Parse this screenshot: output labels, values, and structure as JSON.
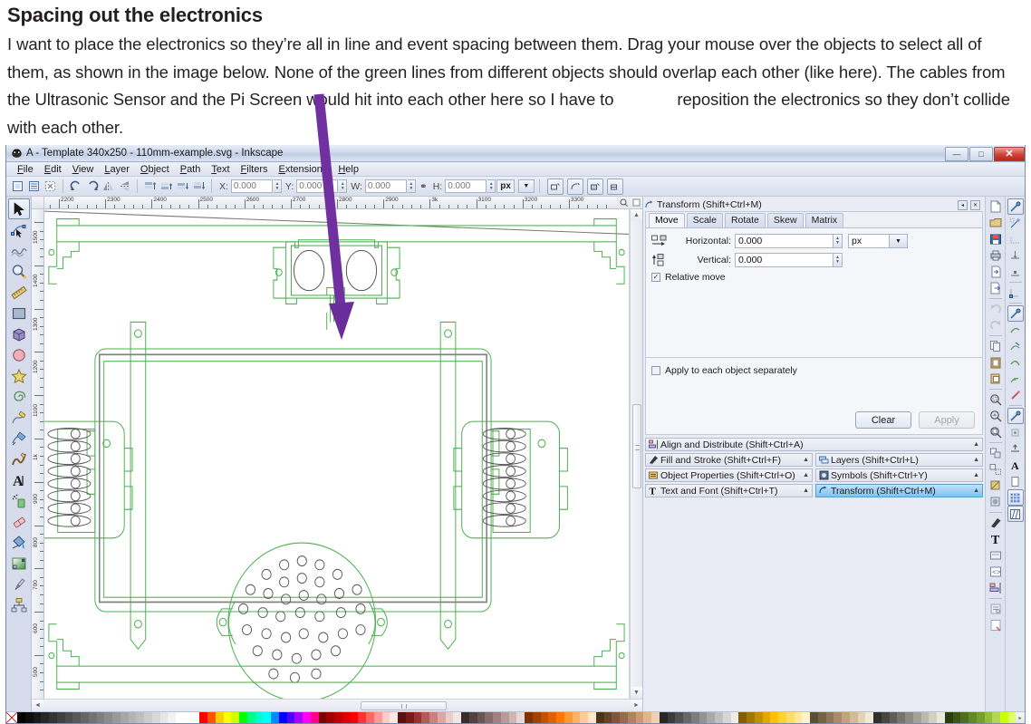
{
  "article": {
    "heading": "Spacing out the electronics",
    "body_part1": "I want to place the electronics so they’re all in line and event spacing between them. Drag your mouse over the objects to select all of them, as shown in the image below. None of the green lines from different objects should overlap each other (like here). The cables from the Ultrasonic Sensor and the Pi Screen would hit into each other here so I have to",
    "body_part2": "reposition the electronics so they don’t collide with each other."
  },
  "window": {
    "title": "A - Template 340x250 - 110mm-example.svg - Inkscape",
    "minimize_label": "—",
    "maximize_label": "□",
    "close_label": "✕"
  },
  "menubar": {
    "items": [
      "File",
      "Edit",
      "View",
      "Layer",
      "Object",
      "Path",
      "Text",
      "Filters",
      "Extensions",
      "Help"
    ]
  },
  "toolctl": {
    "x_label": "X:",
    "x_value": "0.000",
    "y_label": "Y:",
    "y_value": "0.000",
    "w_label": "W:",
    "w_value": "0.000",
    "lock_label": "⚭",
    "h_label": "H:",
    "h_value": "0.000",
    "unit": "px",
    "unit_arrow": "▼"
  },
  "toolbox": {
    "items": [
      {
        "name": "selector-tool",
        "selected": true
      },
      {
        "name": "node-editor-tool",
        "selected": false
      },
      {
        "name": "tweak-tool",
        "selected": false
      },
      {
        "name": "zoom-tool",
        "selected": false
      },
      {
        "name": "measure-tool",
        "selected": false
      },
      {
        "name": "rectangle-tool",
        "selected": false
      },
      {
        "name": "3d-box-tool",
        "selected": false
      },
      {
        "name": "ellipse-tool",
        "selected": false
      },
      {
        "name": "star-tool",
        "selected": false
      },
      {
        "name": "spiral-tool",
        "selected": false
      },
      {
        "name": "pencil-tool",
        "selected": false
      },
      {
        "name": "bezier-pen-tool",
        "selected": false
      },
      {
        "name": "calligraphy-tool",
        "selected": false
      },
      {
        "name": "text-tool",
        "selected": false
      },
      {
        "name": "spray-tool",
        "selected": false
      },
      {
        "name": "eraser-tool",
        "selected": false
      },
      {
        "name": "paint-bucket-tool",
        "selected": false
      },
      {
        "name": "gradient-tool",
        "selected": false
      },
      {
        "name": "dropper-tool",
        "selected": false
      },
      {
        "name": "connector-tool",
        "selected": false
      }
    ]
  },
  "rulers": {
    "horizontal_unit": "px",
    "horizontal_labels": [
      "2200",
      "2300",
      "2400",
      "2500",
      "2600",
      "2700",
      "2800",
      "2900",
      "3k",
      "3100",
      "3200",
      "3300"
    ],
    "vertical_labels": [
      "1500",
      "1400",
      "1300",
      "1200",
      "1100",
      "1k",
      "900",
      "800",
      "700",
      "600",
      "500"
    ]
  },
  "transform_panel": {
    "title": "Transform (Shift+Ctrl+M)",
    "collapse_label": "◂",
    "close_label": "✕",
    "tabs": [
      {
        "label": "Move",
        "active": true
      },
      {
        "label": "Scale",
        "active": false
      },
      {
        "label": "Rotate",
        "active": false
      },
      {
        "label": "Skew",
        "active": false
      },
      {
        "label": "Matrix",
        "active": false
      }
    ],
    "horizontal_label": "Horizontal:",
    "horizontal_value": "0.000",
    "vertical_label": "Vertical:",
    "vertical_value": "0.000",
    "unit": "px",
    "unit_arrow": "▼",
    "relative_move_label": "Relative move",
    "relative_move_checked": true,
    "apply_each_label": "Apply to each object separately",
    "apply_each_checked": false,
    "clear_button": "Clear",
    "apply_button": "Apply"
  },
  "dock_dialogs": [
    {
      "label": "Align and Distribute (Shift+Ctrl+A)",
      "icon": "align-icon",
      "active": false,
      "full_width": true
    },
    {
      "label": "Fill and Stroke (Shift+Ctrl+F)",
      "icon": "fill-stroke-icon",
      "active": false
    },
    {
      "label": "Layers (Shift+Ctrl+L)",
      "icon": "layers-icon",
      "active": false
    },
    {
      "label": "Object Properties (Shift+Ctrl+O)",
      "icon": "object-properties-icon",
      "active": false
    },
    {
      "label": "Symbols (Shift+Ctrl+Y)",
      "icon": "symbols-icon",
      "active": false
    },
    {
      "label": "Text and Font (Shift+Ctrl+T)",
      "icon": "text-font-icon",
      "active": false
    },
    {
      "label": "Transform (Shift+Ctrl+M)",
      "icon": "transform-icon",
      "active": true
    }
  ],
  "command_bar": {
    "items": [
      "new-document-icon",
      "open-document-icon",
      "save-document-icon",
      "print-icon",
      "import-icon",
      "export-icon",
      "undo-icon",
      "redo-icon",
      "copy-icon",
      "paste-icon",
      "duplicate-icon",
      "zoom-selection-icon",
      "zoom-drawing-icon",
      "zoom-page-icon",
      "group-icon",
      "ungroup-icon",
      "clip-icon",
      "mask-icon",
      "fill-stroke-icon",
      "text-font-icon",
      "object-properties-icon",
      "xml-editor-icon",
      "align-icon",
      "preferences-icon",
      "document-properties-icon"
    ]
  },
  "snap_bar": {
    "items": [
      "snap-enable-icon",
      "snap-bbox-icon",
      "snap-bbox-edge-icon",
      "snap-bbox-corner-icon",
      "snap-bbox-midpoint-icon",
      "snap-nodes-icon",
      "snap-paths-icon",
      "snap-path-intersection-icon",
      "snap-cusp-node-icon",
      "snap-smooth-node-icon",
      "snap-midline-icon",
      "snap-others-icon",
      "snap-object-center-icon",
      "snap-rotation-center-icon",
      "snap-text-baseline-icon",
      "snap-page-border-icon",
      "snap-grid-icon",
      "snap-guide-icon"
    ]
  },
  "scrollbars": {
    "v_up": "▲",
    "v_down": "▼",
    "h_left": "◄",
    "h_right": "►",
    "h_thumb_grip": "⦀"
  },
  "palette": {
    "none_swatch": "none",
    "colors": [
      "#000000",
      "#0d0d0d",
      "#1a1a1a",
      "#262626",
      "#333333",
      "#404040",
      "#4d4d4d",
      "#595959",
      "#666666",
      "#737373",
      "#808080",
      "#8c8c8c",
      "#999999",
      "#a6a6a6",
      "#b3b3b3",
      "#bfbfbf",
      "#cccccc",
      "#d9d9d9",
      "#e6e6e6",
      "#f2f2f2",
      "#ffffff",
      "#ffffff",
      "#ffffff",
      "#ff0000",
      "#ff5500",
      "#ffcc00",
      "#ffff00",
      "#ccff00",
      "#00ff00",
      "#00ff88",
      "#00ffcc",
      "#00ffff",
      "#0088ff",
      "#0000ff",
      "#5500ff",
      "#aa00ff",
      "#ff00ff",
      "#ff0088",
      "#800000",
      "#a00000",
      "#c00000",
      "#e00000",
      "#ff0000",
      "#ff3333",
      "#ff6666",
      "#ff9999",
      "#ffcccc",
      "#ffe6e6",
      "#5c1111",
      "#7a1a1a",
      "#993333",
      "#b35959",
      "#cc8080",
      "#dba6a6",
      "#eacccc",
      "#f5e6e6",
      "#3d2b2b",
      "#554040",
      "#6e5555",
      "#876b6b",
      "#a08080",
      "#b89a9a",
      "#d1b5b5",
      "#e8d9d9",
      "#803300",
      "#a04200",
      "#c05200",
      "#e06100",
      "#ff7700",
      "#ff9933",
      "#ffb366",
      "#ffcc99",
      "#ffe6cc",
      "#4d3319",
      "#66442a",
      "#80553a",
      "#996b4d",
      "#b38260",
      "#cc9973",
      "#e6b38c",
      "#f2d1b3",
      "#262626",
      "#3b3b3b",
      "#515151",
      "#676767",
      "#7d7d7d",
      "#939393",
      "#a9a9a9",
      "#c0c0c0",
      "#d6d6d6",
      "#ececec",
      "#806000",
      "#a07800",
      "#c09000",
      "#e0a800",
      "#ffc000",
      "#ffd133",
      "#ffdd66",
      "#ffe999",
      "#fff4cc",
      "#5c4d33",
      "#756244",
      "#8e7856",
      "#a78e69",
      "#c0a47c",
      "#d3bb9a",
      "#e6d2b8",
      "#f2e9dc",
      "#30302a",
      "#474740",
      "#5e5e55",
      "#75756b",
      "#8c8c80",
      "#a3a396",
      "#babaac",
      "#d1d1c2",
      "#e8e8dd",
      "#2b3d10",
      "#3d5517",
      "#506e1e",
      "#628726",
      "#75a02d",
      "#93bf3d",
      "#b3d455",
      "#ccff00",
      "#e0ff66"
    ]
  },
  "drawing": {
    "stroke_color": "#4caf50",
    "screen_outline_color": "#808080",
    "detail_color": "#555555",
    "background": "#ffffff",
    "objects": [
      "top-rail",
      "ultrasonic-sensor",
      "pi-screen",
      "left-vent-panel",
      "right-vent-panel",
      "speaker-grille",
      "bottom-rail"
    ]
  },
  "annotation": {
    "arrow_color": "#7030a0",
    "name": "purple-arrow-annotation"
  }
}
